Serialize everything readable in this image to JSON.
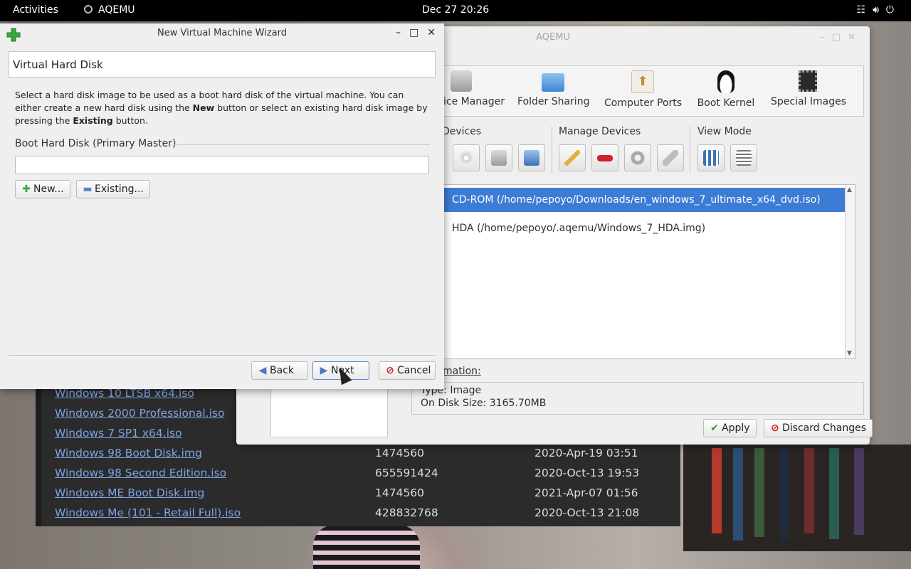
{
  "topbar": {
    "activities": "Activities",
    "app_name": "AQEMU",
    "clock": "Dec 27  20:26",
    "icons": [
      "network-icon",
      "volume-icon",
      "power-icon"
    ]
  },
  "filelist": {
    "rows": [
      {
        "name": "Windows 10 LTSB x64.iso",
        "size": "",
        "date": ""
      },
      {
        "name": "Windows 2000 Professional.iso",
        "size": "",
        "date": ""
      },
      {
        "name": "Windows 7 SP1 x64.iso",
        "size": "",
        "date": ""
      },
      {
        "name": "Windows 98 Boot Disk.img",
        "size": "1474560",
        "date": "2020-Apr-19 03:51"
      },
      {
        "name": "Windows 98 Second Edition.iso",
        "size": "655591424",
        "date": "2020-Oct-13 19:53"
      },
      {
        "name": "Windows ME Boot Disk.img",
        "size": "1474560",
        "date": "2021-Apr-07 01:56"
      },
      {
        "name": "Windows Me (101 - Retail Full).iso",
        "size": "428832768",
        "date": "2020-Oct-13 21:08"
      }
    ]
  },
  "aqemu": {
    "title": "AQEMU",
    "tools": [
      {
        "label": "ice Manager",
        "icon": "harddisk-icon"
      },
      {
        "label": "Folder Sharing",
        "icon": "folder-icon"
      },
      {
        "label": "Computer Ports",
        "icon": "usb-icon"
      },
      {
        "label": "Boot Kernel",
        "icon": "tux-icon"
      },
      {
        "label": "Special Images",
        "icon": "chip-icon"
      }
    ],
    "groups": {
      "devices": "Devices",
      "manage_devices": "Manage Devices",
      "view_mode": "View Mode"
    },
    "devices": [
      {
        "label": "CD-ROM (/home/pepoyo/Downloads/en_windows_7_ultimate_x64_dvd.iso)",
        "selected": true
      },
      {
        "label": "HDA (/home/pepoyo/.aqemu/Windows_7_HDA.img)",
        "selected": false
      }
    ],
    "info_label": "mation:",
    "info_type": "Type: Image",
    "info_size": "On Disk Size: 3165.70MB",
    "apply": "Apply",
    "discard": "Discard Changes"
  },
  "wizard": {
    "title": "New Virtual Machine Wizard",
    "page_title": "Virtual Hard Disk",
    "desc_1": "Select a hard disk image to be used as a boot hard disk of the virtual machine. You can either create a new hard disk using the ",
    "desc_new": "New",
    "desc_2": " button or select an existing hard disk image by pressing the ",
    "desc_existing": "Existing",
    "desc_3": " button.",
    "group_title": "Boot Hard Disk (Primary Master)",
    "hd_value": "",
    "new_button": "New...",
    "existing_button": "Existing...",
    "back_button": "Back",
    "next_button": "Next",
    "cancel_button": "Cancel"
  },
  "colors": {
    "selection": "#3d7cd5",
    "link": "#7da2e0",
    "topbar": "#000000"
  }
}
